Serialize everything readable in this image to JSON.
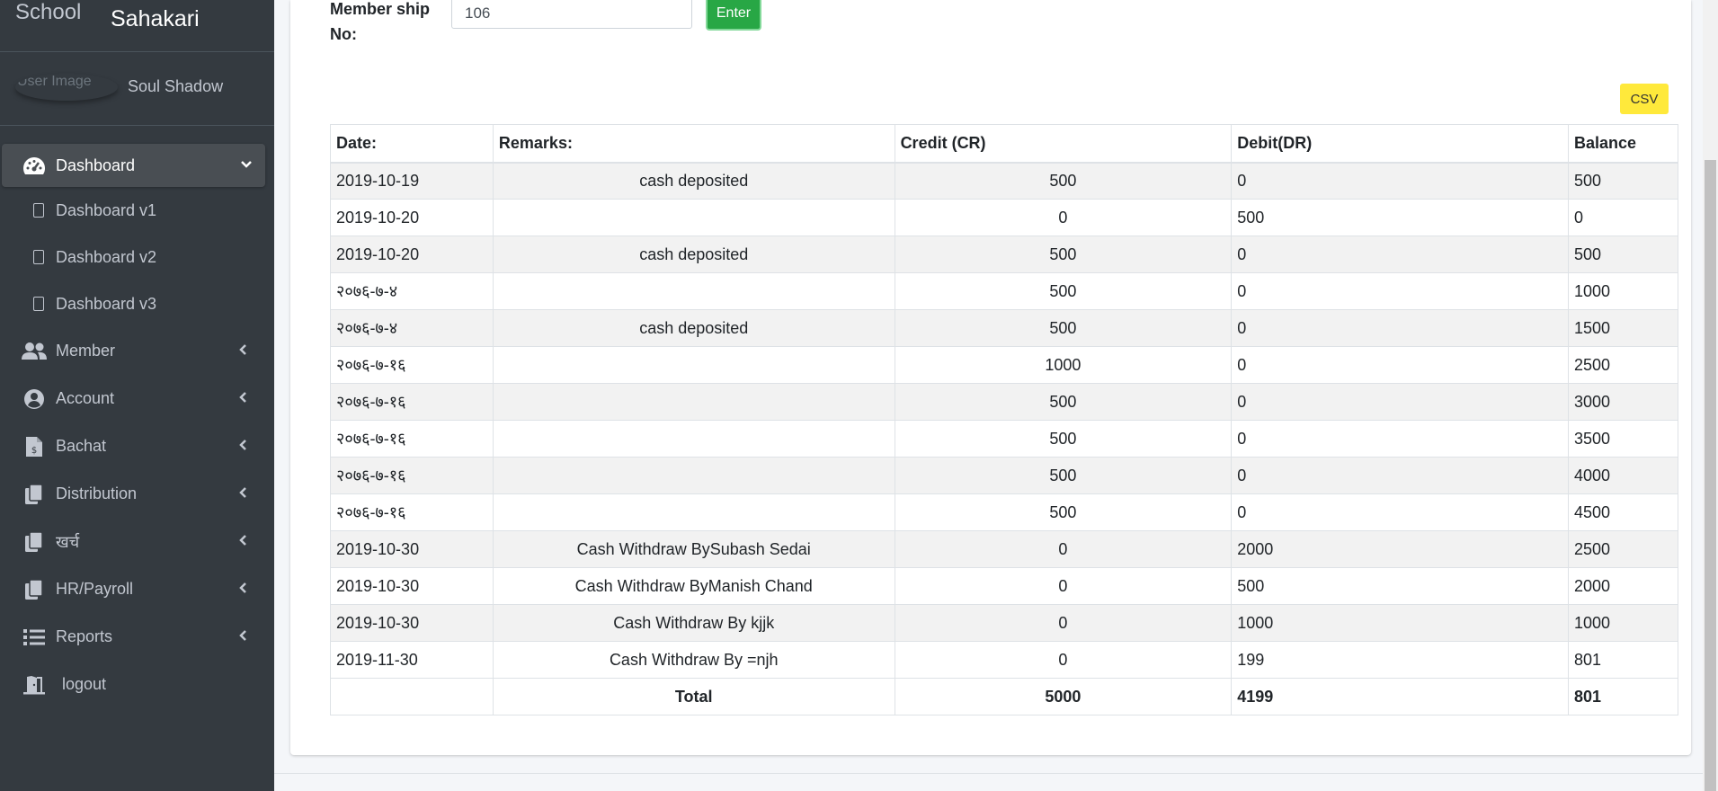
{
  "brand": {
    "logo_alt": "School",
    "title": "Sahakari"
  },
  "user": {
    "image_alt": "User Image",
    "name": "Soul Shadow"
  },
  "nav": {
    "dashboard": "Dashboard",
    "dashboard_v1": "Dashboard v1",
    "dashboard_v2": "Dashboard v2",
    "dashboard_v3": "Dashboard v3",
    "member": "Member",
    "account": "Account",
    "bachat": "Bachat",
    "distribution": "Distribution",
    "kharcha": "खर्च",
    "hr_payroll": "HR/Payroll",
    "reports": "Reports",
    "logout": "logout"
  },
  "form": {
    "member_label": "Member ship No:",
    "member_value": "106",
    "enter_label": "Enter"
  },
  "csv_label": "CSV",
  "table": {
    "headers": [
      "Date:",
      "Remarks:",
      "Credit (CR)",
      "Debit(DR)",
      "Balance"
    ],
    "rows": [
      [
        "2019-10-19",
        "cash deposited",
        "500",
        "0",
        "500"
      ],
      [
        "2019-10-20",
        "",
        "0",
        "500",
        "0"
      ],
      [
        "2019-10-20",
        "cash deposited",
        "500",
        "0",
        "500"
      ],
      [
        "२०७६-७-४",
        "",
        "500",
        "0",
        "1000"
      ],
      [
        "२०७६-७-४",
        "cash deposited",
        "500",
        "0",
        "1500"
      ],
      [
        "२०७६-७-१६",
        "",
        "1000",
        "0",
        "2500"
      ],
      [
        "२०७६-७-१६",
        "",
        "500",
        "0",
        "3000"
      ],
      [
        "२०७६-७-१६",
        "",
        "500",
        "0",
        "3500"
      ],
      [
        "२०७६-७-१६",
        "",
        "500",
        "0",
        "4000"
      ],
      [
        "२०७६-७-१६",
        "",
        "500",
        "0",
        "4500"
      ],
      [
        "2019-10-30",
        "Cash Withdraw BySubash Sedai",
        "0",
        "2000",
        "2500"
      ],
      [
        "2019-10-30",
        "Cash Withdraw ByManish Chand",
        "0",
        "500",
        "2000"
      ],
      [
        "2019-10-30",
        "Cash Withdraw By kjjk",
        "0",
        "1000",
        "1000"
      ],
      [
        "2019-11-30",
        "Cash Withdraw By =njh",
        "0",
        "199",
        "801"
      ]
    ],
    "total": {
      "label": "Total",
      "credit": "5000",
      "debit": "4199",
      "balance": "801"
    }
  }
}
